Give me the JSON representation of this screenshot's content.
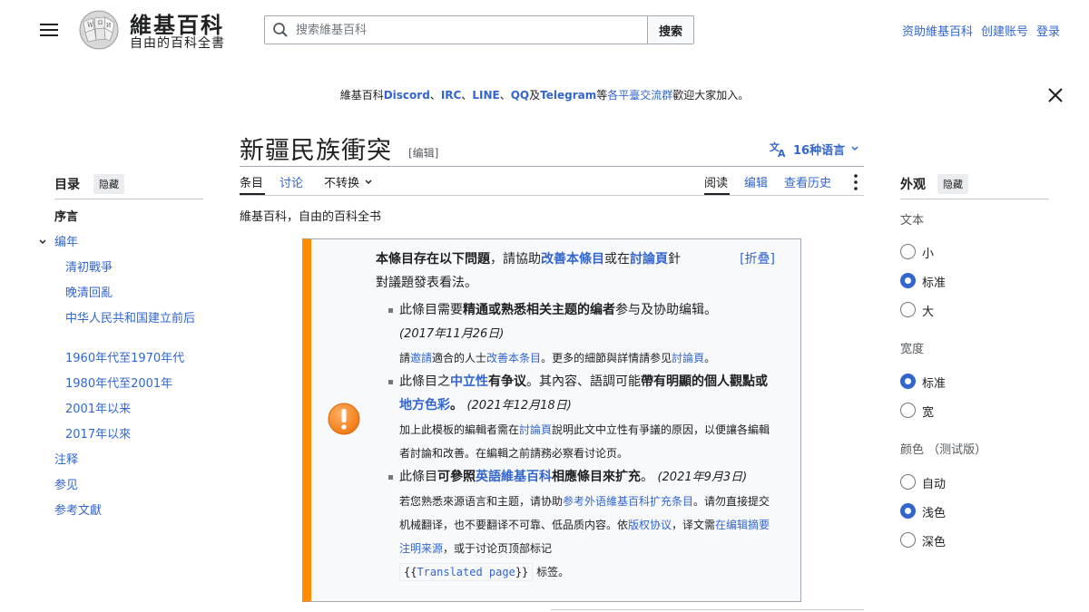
{
  "header": {
    "logo_title": "維基百科",
    "logo_tagline": "自由的百科全書",
    "search_placeholder": "搜索維基百科",
    "search_button": "搜索",
    "user_links": [
      "资助維基百科",
      "创建账号",
      "登录"
    ]
  },
  "banner": {
    "prefix": "維基百科",
    "discord": "Discord",
    "sep1": "、",
    "irc": "IRC",
    "sep2": "、",
    "line": "LINE",
    "sep3": "、",
    "qq": "QQ",
    "and": "及",
    "telegram": "Telegram",
    "etc": "等",
    "platforms": "各平臺交流群",
    "welcome": "歡迎大家加入。"
  },
  "article": {
    "title": "新疆民族衝突",
    "edit_label": "[编辑]",
    "languages": "16种语言",
    "subtitle": "維基百科，自由的百科全书"
  },
  "tabs": {
    "article": "条目",
    "talk": "讨论",
    "variant": "不转换",
    "read": "阅读",
    "edit": "编辑",
    "history": "查看历史"
  },
  "toc": {
    "title": "目录",
    "hide": "隐藏",
    "intro": "序言",
    "chronology": "编年",
    "subitems": [
      "清初戰爭",
      "晚清回亂",
      "中华人民共和国建立前后",
      "1960年代至1970年代",
      "1980年代至2001年",
      "2001年以来",
      "2017年以來"
    ],
    "notes": "注释",
    "see_also": "参见",
    "references": "参考文獻"
  },
  "appearance": {
    "title": "外观",
    "hide": "隐藏",
    "text_heading": "文本",
    "text_options": [
      "小",
      "标准",
      "大"
    ],
    "text_selected": "标准",
    "width_heading": "宽度",
    "width_options": [
      "标准",
      "宽"
    ],
    "width_selected": "标准",
    "color_heading": "颜色 （测试版）",
    "color_options": [
      "自动",
      "浅色",
      "深色"
    ],
    "color_selected": "浅色"
  },
  "ambox": {
    "head_bold": "本條目存在以下問題",
    "head_mid": "，請協助",
    "head_link1": "改善本條目",
    "head_or": "或在",
    "head_link2": "討論頁",
    "head_for": "針",
    "collapse": "[折叠]",
    "head_end": "對議題發表看法。",
    "issue1_a": "此條目需要",
    "issue1_bold": "精通或熟悉相关主题的编者",
    "issue1_b": "参与及协助编辑。",
    "issue1_date": "(2017年11月26日)",
    "issue1_note_a": "請",
    "issue1_note_link1": "邀請",
    "issue1_note_b": "適合的人士",
    "issue1_note_link2": "改善本条目",
    "issue1_note_c": "。更多的細節與詳情請参见",
    "issue1_note_link3": "討論頁",
    "issue1_note_d": "。",
    "issue2_a": "此條目之",
    "issue2_link1": "中立性",
    "issue2_b": "有争议",
    "issue2_c": "。其內容、語調可能",
    "issue2_bold": "帶有明顯的個人觀點或",
    "issue2_link2": "地方色彩",
    "issue2_d": "。",
    "issue2_date": "(2021年12月18日)",
    "issue2_note_a": "加上此模板的編輯者需在",
    "issue2_note_link": "討論頁",
    "issue2_note_b": "說明此文中立性有爭議的原因，以便讓各編輯者討論和改善。在編輯之前請務必察看讨论页。",
    "issue3_a": "此條目",
    "issue3_bold1": "可參照",
    "issue3_link": "英語維基百科",
    "issue3_bold2": "相應條目來扩充",
    "issue3_b": "。",
    "issue3_date": "(2021年9月3日)",
    "issue3_note_a": "若您熟悉來源语言和主题，请协助",
    "issue3_note_link1": "参考外语維基百科扩充条目",
    "issue3_note_b": "。请勿直接提交机械翻译，也不要翻译不可靠、低品质内容。依",
    "issue3_note_link2": "版权协议",
    "issue3_note_c": "，译文需",
    "issue3_note_link3": "在编辑摘要注明来源",
    "issue3_note_d": "，或于讨论页顶部标记",
    "issue3_code_a": "{{",
    "issue3_code_link": "Translated page",
    "issue3_code_b": "}}",
    "issue3_note_e": "标签。"
  },
  "colors": {
    "link": "#3366cc",
    "ambox_border": "#ff8c00",
    "text": "#202122"
  }
}
